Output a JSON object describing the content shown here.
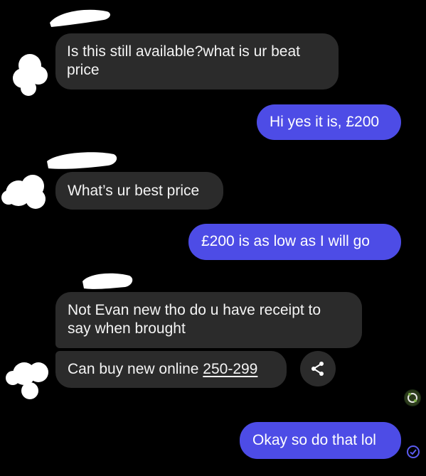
{
  "colors": {
    "background": "#000000",
    "incoming_bubble": "#2b2b2b",
    "outgoing_bubble": "#4d4ce6",
    "text": "#f4f4f4",
    "seen_check": "#5b5bf0"
  },
  "messages": [
    {
      "direction": "incoming",
      "lines": [
        "Is this still available?what is ur beat",
        "price"
      ]
    },
    {
      "direction": "outgoing",
      "lines": [
        "Hi yes it is, £200"
      ]
    },
    {
      "direction": "incoming",
      "lines": [
        "What’s ur best price"
      ]
    },
    {
      "direction": "outgoing",
      "lines": [
        "£200 is as low as I will go"
      ]
    },
    {
      "direction": "incoming",
      "lines": [
        "Not Evan new tho do u have receipt to",
        "say when brought"
      ]
    },
    {
      "direction": "incoming",
      "text": "Can buy new online ",
      "link": "250-299"
    },
    {
      "direction": "outgoing",
      "lines": [
        "Okay so do that lol"
      ]
    }
  ],
  "icons": {
    "share": "share-icon",
    "seen": "seen-check-icon",
    "avatar": "contact-avatar"
  }
}
